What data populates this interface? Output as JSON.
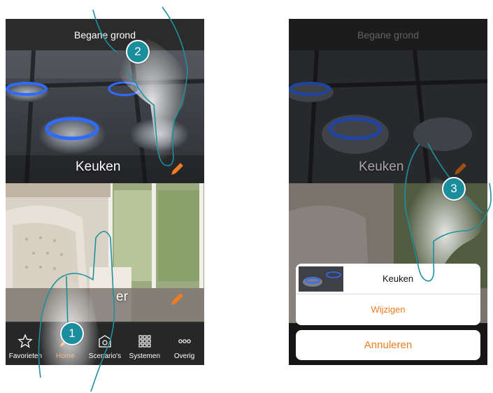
{
  "screen1": {
    "header": "Begane grond",
    "rooms": [
      {
        "name": "Keuken"
      },
      {
        "name": "Woonkamer",
        "visible_fragment": "er"
      }
    ],
    "tabs": [
      {
        "label": "Favorieten",
        "icon": "star-icon"
      },
      {
        "label": "Home",
        "icon": "pencil-icon",
        "active": true
      },
      {
        "label": "Scenario's",
        "icon": "scenario-icon"
      },
      {
        "label": "Systemen",
        "icon": "grid-icon"
      },
      {
        "label": "Overig",
        "icon": "more-icon"
      }
    ]
  },
  "screen2": {
    "header": "Begane grond",
    "room_label": "Keuken",
    "action_sheet": {
      "title": "Keuken",
      "action": "Wijzigen",
      "cancel": "Annuleren"
    }
  },
  "steps": [
    "1",
    "2",
    "3"
  ],
  "colors": {
    "accent": "#f07b20",
    "step_badge": "#1a8e9c",
    "hand_outline": "#1f8fa0",
    "flame": "#2f6bff"
  }
}
